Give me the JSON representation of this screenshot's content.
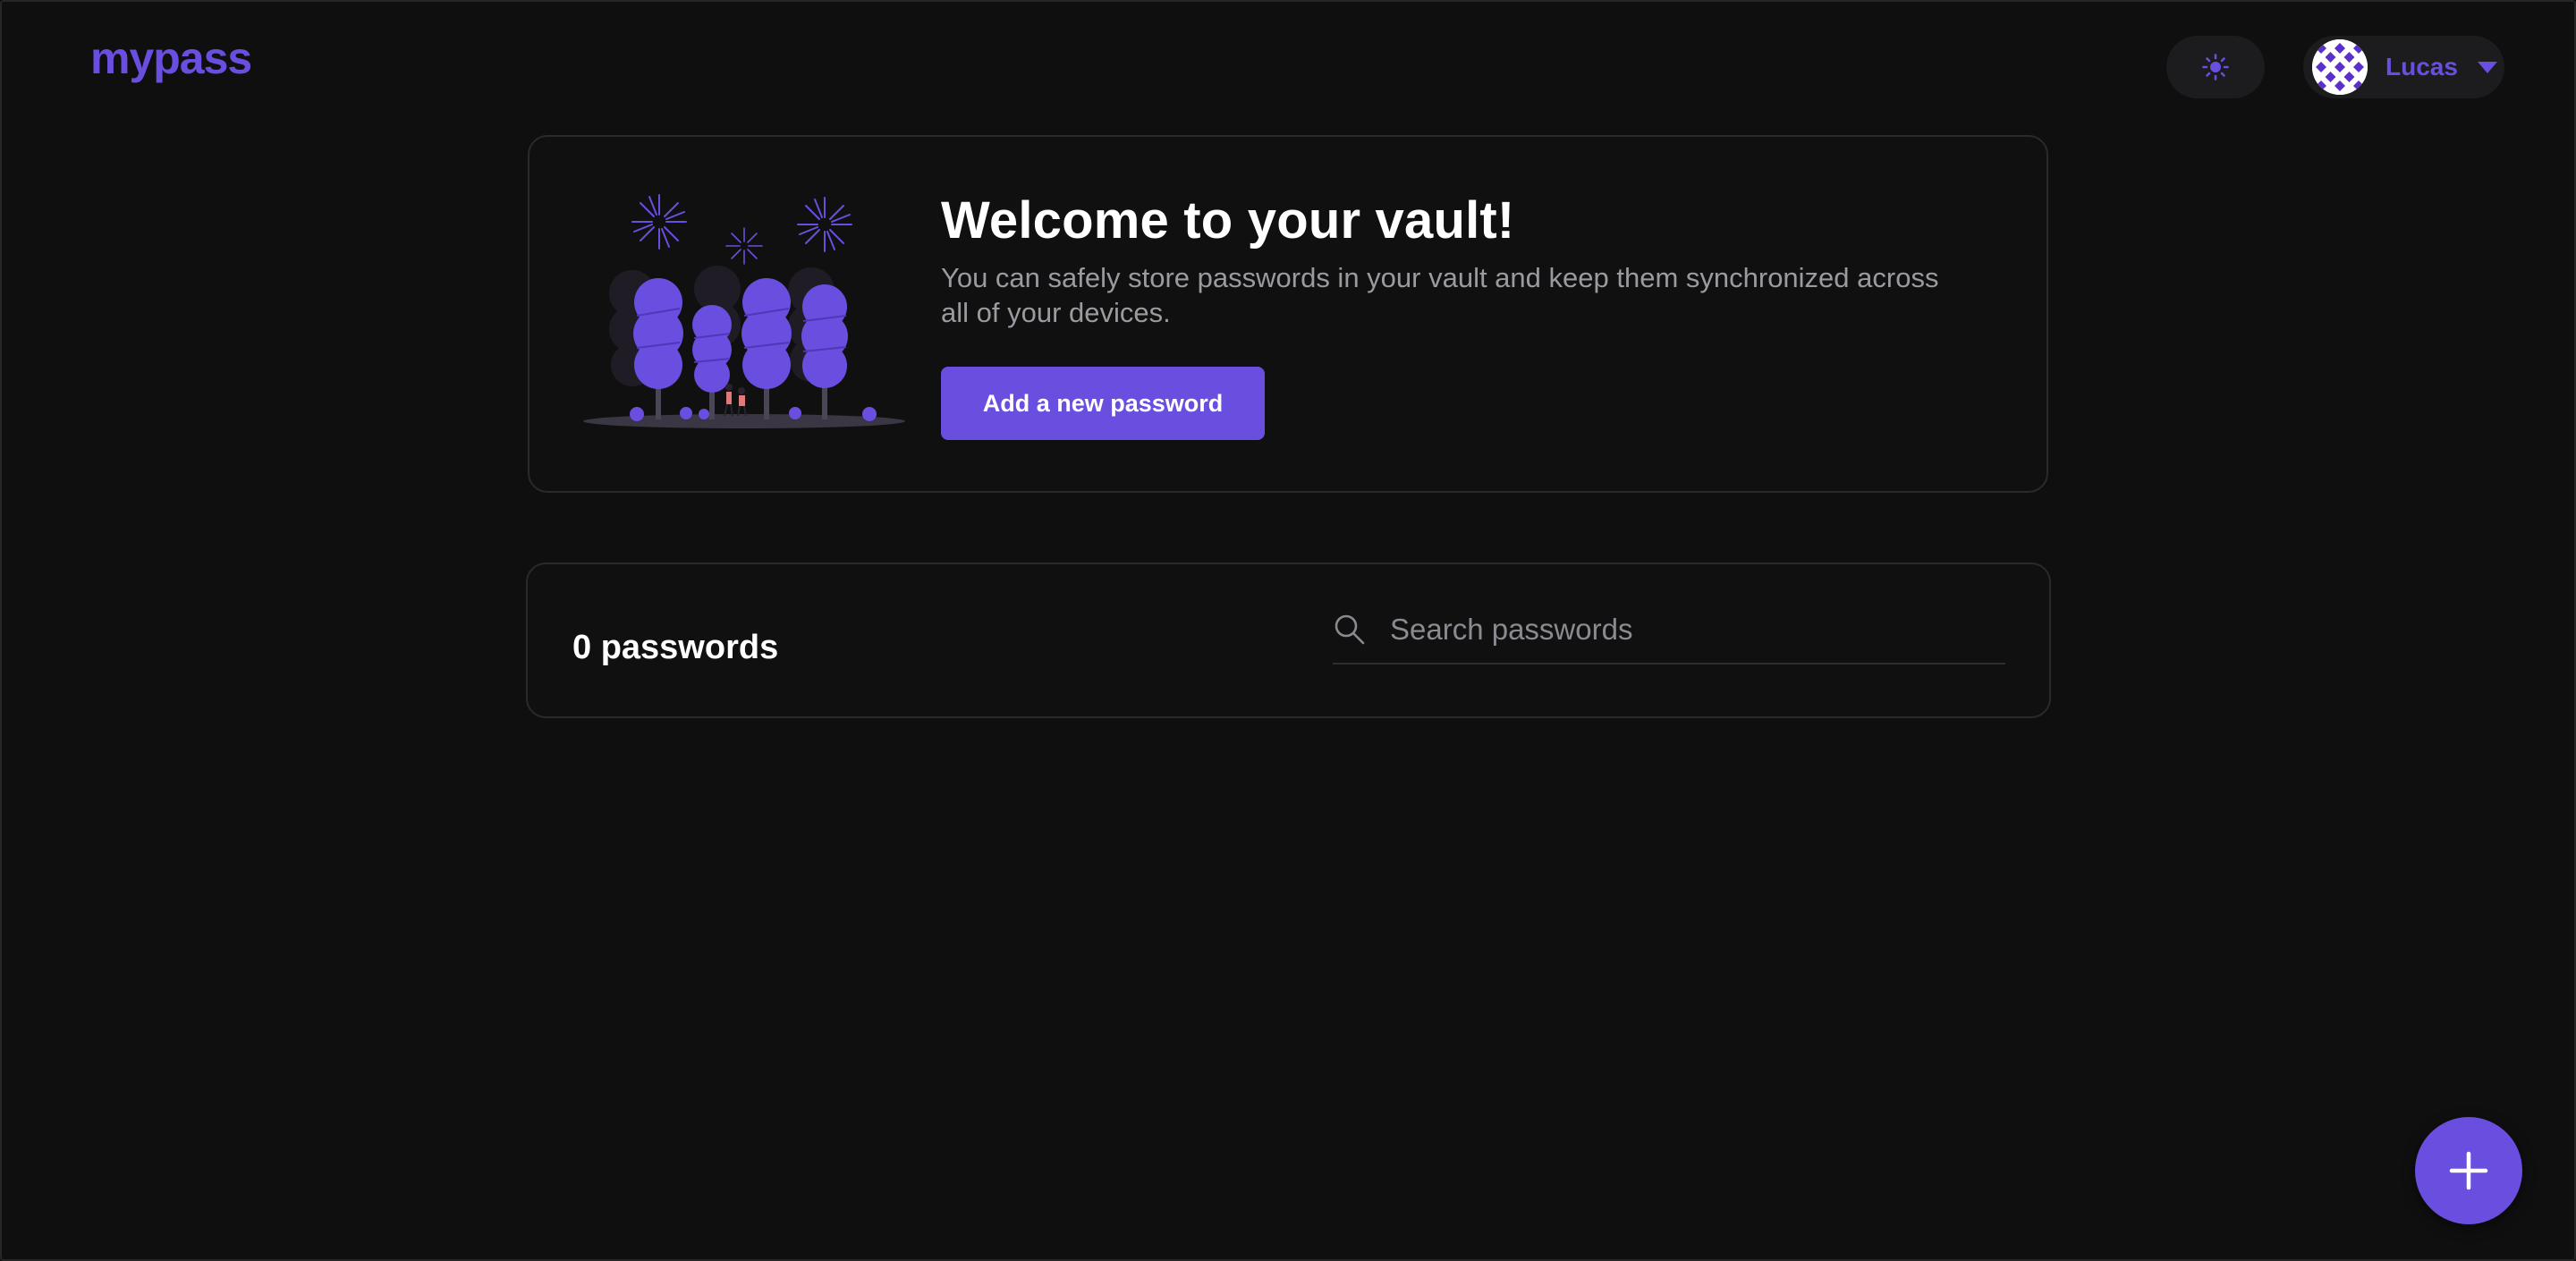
{
  "header": {
    "logo_text": "mypass",
    "theme_toggle_icon": "sun-icon",
    "user": {
      "name": "Lucas",
      "avatar_icon": "avatar",
      "menu_icon": "caret-down-icon"
    }
  },
  "welcome": {
    "title": "Welcome to your vault!",
    "description": "You can safely store passwords in your vault and keep them synchronized across all of your devices.",
    "add_button_label": "Add a new password",
    "illustration": "forest-fireworks-illustration"
  },
  "passwords": {
    "count_label": "0 passwords",
    "search_placeholder": "Search passwords",
    "search_value": "",
    "search_icon": "search-icon"
  },
  "fab": {
    "icon": "plus-icon"
  },
  "colors": {
    "accent": "#6a4ee0",
    "background": "#0f0f0f",
    "card_border": "#2a2a2c",
    "muted_text": "#9a9aa0"
  }
}
